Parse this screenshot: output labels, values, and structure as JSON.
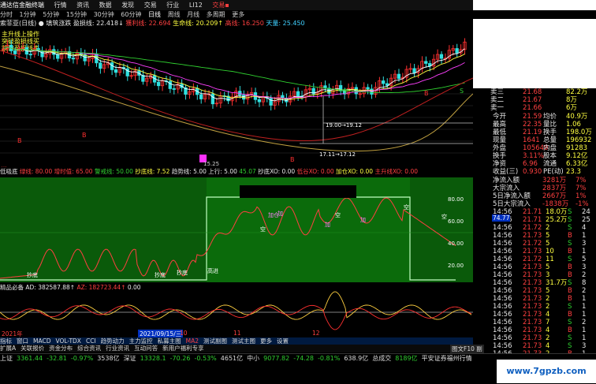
{
  "titlebar": {
    "app_title": "通达信金融终端",
    "menus": [
      "行情",
      "资讯",
      "数据",
      "发现",
      "交易",
      "行业",
      "LI12"
    ],
    "trade_label": "交易▪"
  },
  "toolbar": {
    "periods": [
      "分时",
      "1分钟",
      "5分钟",
      "15分钟",
      "30分钟",
      "60分钟",
      "日线",
      "周线",
      "月线",
      "多周期",
      "更多"
    ],
    "active_period": "日线"
  },
  "main": {
    "header1": {
      "label": "索菲亚(日线)",
      "items": [
        "● 填筑涨跌",
        "盈损线: 22.418↓",
        "獲利线: 22.694",
        "生命线: 20.209↑",
        "高线: 16.250",
        "天量: 25.450"
      ]
    },
    "left_labels": [
      "主升线上操作",
      "突破盈损线买",
      "跌破盈损线卖"
    ],
    "price_axis": [
      "22.00",
      "21.00",
      "20.00",
      "19.00",
      "18.00",
      "17.00"
    ],
    "annotations": [
      "19.00→19.12",
      "17.11→17.12",
      "一字",
      "B",
      "B",
      "B",
      "B",
      "S"
    ],
    "low_label": "15.25",
    "bottom_label": "增"
  },
  "ind1": {
    "header": [
      "低吸底",
      "绿线: 80.00",
      "增时值: 65.00",
      "警戒线: 50.00",
      "抄底线: 7.52",
      "趋势线: 5.00",
      "上行: 5.00",
      "45.07",
      "抄底XO: 0.00",
      "低谷XO: 0.00",
      "加仓XO: 0.00",
      "主升线XO: 0.00",
      "拐线XO: 0.00",
      "绿线XO: 50"
    ],
    "axis": [
      "80.00",
      "60.00",
      "40.00",
      "20.00"
    ],
    "tags": [
      "抄底",
      "抄底",
      "抄底",
      "高进",
      "加仓",
      "加",
      "空",
      "加",
      "空",
      "加",
      "空",
      "空"
    ],
    "value_tag": "74.77"
  },
  "ind2": {
    "header": [
      "精品必备",
      "AD: 382587.88↑",
      "AZ: 182723.44↑",
      "0.00"
    ],
    "axis": [
      "10000",
      "5000",
      "0",
      "-5000"
    ]
  },
  "rightpanel": {
    "order_book": [
      {
        "k": "卖三",
        "p": "21.68",
        "v": "82.2万"
      },
      {
        "k": "卖二",
        "p": "21.67",
        "v": "8万"
      },
      {
        "k": "卖一",
        "p": "21.66",
        "v": "6万"
      }
    ],
    "stats": [
      {
        "k": "今开",
        "v1": "21.59",
        "k2": "均价",
        "v2": "40.9万"
      },
      {
        "k": "最高",
        "v1": "22.35",
        "k2": "量比",
        "v2": "1.06"
      },
      {
        "k": "最低",
        "v1": "21.19",
        "k2": "换手",
        "v2": "198.0万"
      },
      {
        "k": "现量",
        "v1": "1641",
        "k2": "总量",
        "v2": "196932"
      },
      {
        "k": "外盘",
        "v1": "105649",
        "k2": "内盘",
        "v2": "91283"
      },
      {
        "k": "换手",
        "v1": "3.11%",
        "k2": "股本",
        "v2": "9.12亿"
      },
      {
        "k": "净资",
        "v1": "6.96",
        "k2": "流通",
        "v2": "6.33亿"
      },
      {
        "k": "收益(三)",
        "v1": "0.930",
        "k2": "PE(动)",
        "v2": "23.3"
      }
    ],
    "flows": [
      {
        "k": "净流入额",
        "v": "3281万",
        "p": "7%"
      },
      {
        "k": "大宗流入",
        "v": "2837万",
        "p": "7%"
      },
      {
        "k": "5日净流入额",
        "v": "2667万",
        "p": "1%"
      },
      {
        "k": "5日大宗流入",
        "v": "-1838万",
        "p": "-1%"
      }
    ],
    "ticks": [
      {
        "t": "14:56",
        "p": "21.71",
        "v": "18.0万",
        "d": "S",
        "n": "24"
      },
      {
        "t": "14:56",
        "p": "21.71",
        "v": "25.2万",
        "d": "S",
        "n": "25"
      },
      {
        "t": "14:56",
        "p": "21.72",
        "v": "2",
        "d": "S",
        "n": "4"
      },
      {
        "t": "14:56",
        "p": "21.73",
        "v": "5",
        "d": "B",
        "n": "1"
      },
      {
        "t": "14:56",
        "p": "21.72",
        "v": "5",
        "d": "S",
        "n": "3"
      },
      {
        "t": "14:56",
        "p": "21.73",
        "v": "10",
        "d": "B",
        "n": "1"
      },
      {
        "t": "14:56",
        "p": "21.72",
        "v": "11",
        "d": "S",
        "n": "5"
      },
      {
        "t": "14:56",
        "p": "21.73",
        "v": "5",
        "d": "B",
        "n": "3"
      },
      {
        "t": "14:56",
        "p": "21.73",
        "v": "3",
        "d": "B",
        "n": "2"
      },
      {
        "t": "14:56",
        "p": "21.73",
        "v": "31.7万",
        "d": "S",
        "n": "8"
      },
      {
        "t": "14:56",
        "p": "21.73",
        "v": "5",
        "d": "B",
        "n": "2"
      },
      {
        "t": "14:56",
        "p": "21.73",
        "v": "2",
        "d": "B",
        "n": "1"
      },
      {
        "t": "14:56",
        "p": "21.73",
        "v": "2",
        "d": "S",
        "n": "1"
      },
      {
        "t": "14:56",
        "p": "21.73",
        "v": "4",
        "d": "B",
        "n": "1"
      },
      {
        "t": "14:56",
        "p": "21.73",
        "v": "7",
        "d": "S",
        "n": "2"
      },
      {
        "t": "14:56",
        "p": "21.73",
        "v": "4",
        "d": "B",
        "n": "1"
      },
      {
        "t": "14:56",
        "p": "21.73",
        "v": "2",
        "d": "S",
        "n": "1"
      },
      {
        "t": "14:56",
        "p": "21.73",
        "v": "4",
        "d": "S",
        "n": "3"
      },
      {
        "t": "14:56",
        "p": "21.73",
        "v": "2",
        "d": "B",
        "n": "1"
      },
      {
        "t": "14:56",
        "p": "21.73",
        "v": "4",
        "d": "S",
        "n": "2"
      }
    ]
  },
  "bottom": {
    "dates": [
      "2021年",
      "2021/09/15/三",
      "10",
      "11",
      "12"
    ],
    "tabs1": [
      "指标",
      "窗口",
      "MACD",
      "VOL-TDX",
      "CCI",
      "趋势动力",
      "主力监控",
      "私募主图",
      "MA2",
      "测试副图",
      "测试主图",
      "更多",
      "设置"
    ],
    "tabs2": [
      "扩展A",
      "关联报价",
      "资金分布",
      "综合资讯",
      "行业资讯",
      "互动问答",
      "新用户福利专享"
    ],
    "ticker": [
      {
        "k": "上证",
        "v": "3361.44",
        "c": "-32.81",
        "p": "-0.97%",
        "a": "3538亿"
      },
      {
        "k": "深证",
        "v": "13328.1",
        "c": "-70.26",
        "p": "-0.53%",
        "a": "4651亿"
      },
      {
        "k": "中小",
        "v": "9077.82",
        "c": "-74.28",
        "p": "-0.81%",
        "a": "638.9亿"
      },
      {
        "k": "总成交",
        "v": "8189亿"
      }
    ],
    "ticker_tail": "平安证券福州行情",
    "corner": "图文F10 副"
  },
  "watermark": "www.7gpzb.com"
}
